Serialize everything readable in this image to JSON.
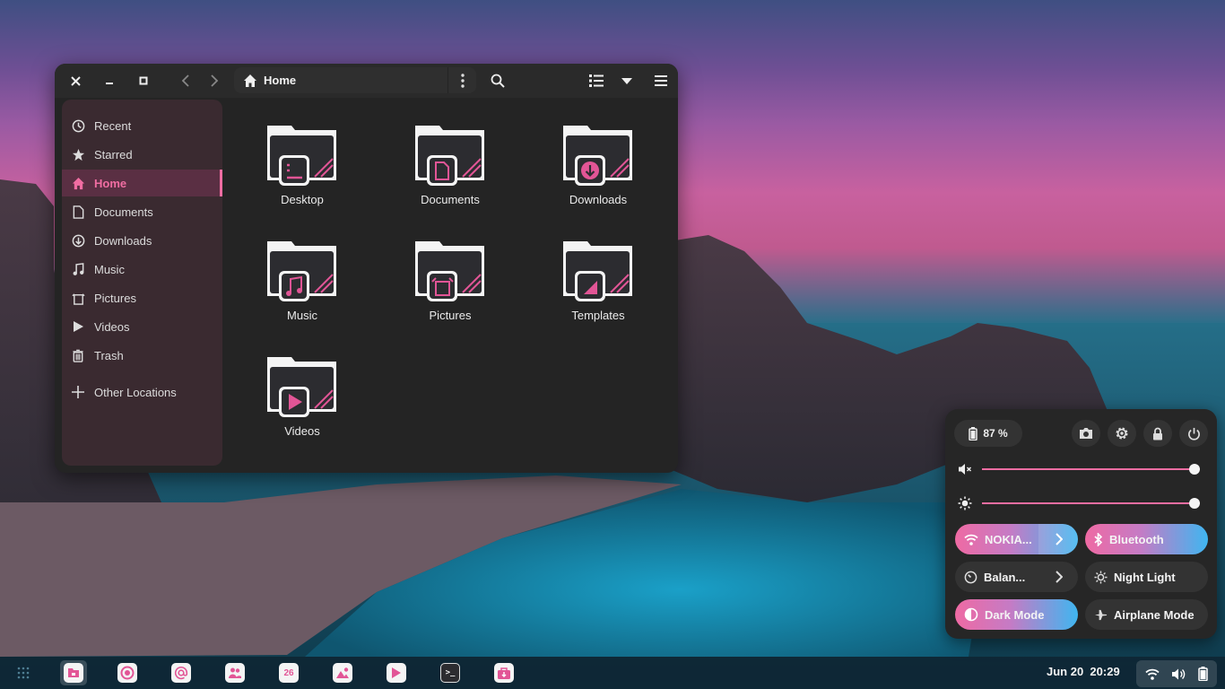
{
  "window": {
    "path_label": "Home",
    "controls": [
      "close",
      "minimize",
      "maximize"
    ]
  },
  "sidebar": {
    "items": [
      {
        "label": "Recent",
        "icon": "clock-icon"
      },
      {
        "label": "Starred",
        "icon": "star-icon"
      },
      {
        "label": "Home",
        "icon": "home-icon",
        "active": true
      },
      {
        "label": "Documents",
        "icon": "document-icon"
      },
      {
        "label": "Downloads",
        "icon": "download-icon"
      },
      {
        "label": "Music",
        "icon": "music-icon"
      },
      {
        "label": "Pictures",
        "icon": "picture-icon"
      },
      {
        "label": "Videos",
        "icon": "video-icon"
      },
      {
        "label": "Trash",
        "icon": "trash-icon"
      },
      {
        "label": "Other Locations",
        "icon": "plus-icon"
      }
    ]
  },
  "folders": [
    {
      "label": "Desktop",
      "emblem": "desktop"
    },
    {
      "label": "Documents",
      "emblem": "document"
    },
    {
      "label": "Downloads",
      "emblem": "download"
    },
    {
      "label": "Music",
      "emblem": "music"
    },
    {
      "label": "Pictures",
      "emblem": "picture"
    },
    {
      "label": "Templates",
      "emblem": "template"
    },
    {
      "label": "Videos",
      "emblem": "video"
    }
  ],
  "quick_settings": {
    "battery": "87 %",
    "volume_level": 1.0,
    "brightness_level": 1.0,
    "toggles": {
      "wifi": {
        "label": "NOKIA...",
        "on": true
      },
      "bluetooth": {
        "label": "Bluetooth",
        "on": true
      },
      "power_mode": {
        "label": "Balan...",
        "on": false
      },
      "night_light": {
        "label": "Night Light",
        "on": false
      },
      "dark_mode": {
        "label": "Dark Mode",
        "on": true
      },
      "airplane": {
        "label": "Airplane Mode",
        "on": false
      }
    }
  },
  "taskbar": {
    "apps": [
      "files",
      "firefox",
      "mail",
      "contacts",
      "calendar",
      "photos",
      "videos",
      "terminal",
      "software"
    ],
    "calendar_day": "26",
    "terminal_glyph": ">_",
    "date": "Jun 20",
    "time": "20:29"
  },
  "colors": {
    "accent": "#f06da2",
    "window_bg": "#242424",
    "sidebar_bg": "#3a2a30",
    "toggle_gradient_end": "#3fb6f0"
  }
}
